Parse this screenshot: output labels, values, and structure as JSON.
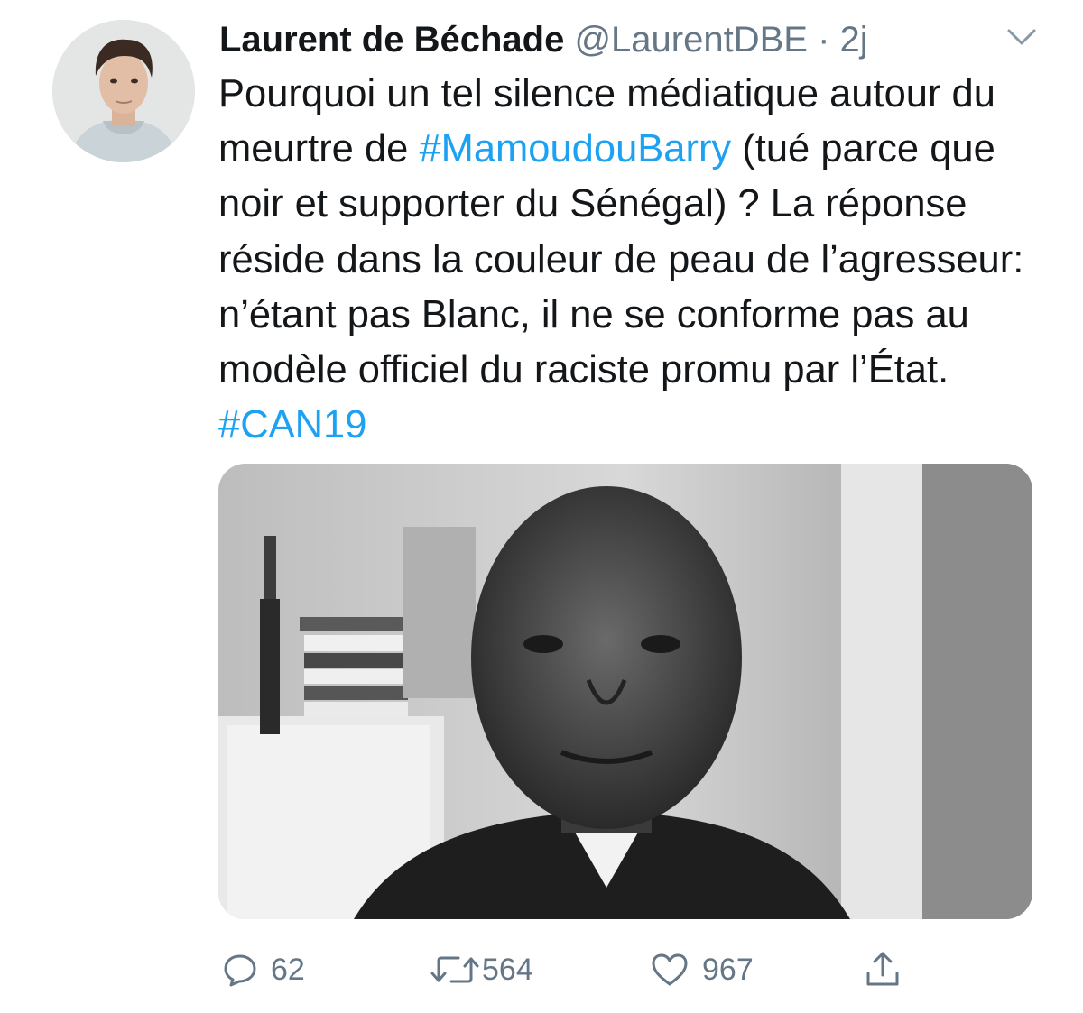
{
  "tweet": {
    "author_name": "Laurent de Béchade",
    "handle": "@LaurentDBE",
    "separator": "·",
    "time": "2j",
    "text_parts": [
      "Pourquoi un tel silence médiatique autour du meurtre de ",
      "#MamoudouBarry",
      " (tué parce que noir et supporter du Sénégal) ? La réponse réside dans la couleur de peau de l’agresseur: n’étant pas Blanc, il ne se conforme pas au modèle officiel du raciste promu par l’État. ",
      "#CAN19"
    ]
  },
  "actions": {
    "reply_count": "62",
    "retweet_count": "564",
    "like_count": "967"
  },
  "icons": {
    "menu": "chevron-down-icon",
    "reply": "reply-icon",
    "retweet": "retweet-icon",
    "like": "heart-icon",
    "share": "share-icon"
  },
  "colors": {
    "text": "#14171a",
    "secondary": "#657786",
    "link": "#1da1f2",
    "background": "#ffffff"
  }
}
